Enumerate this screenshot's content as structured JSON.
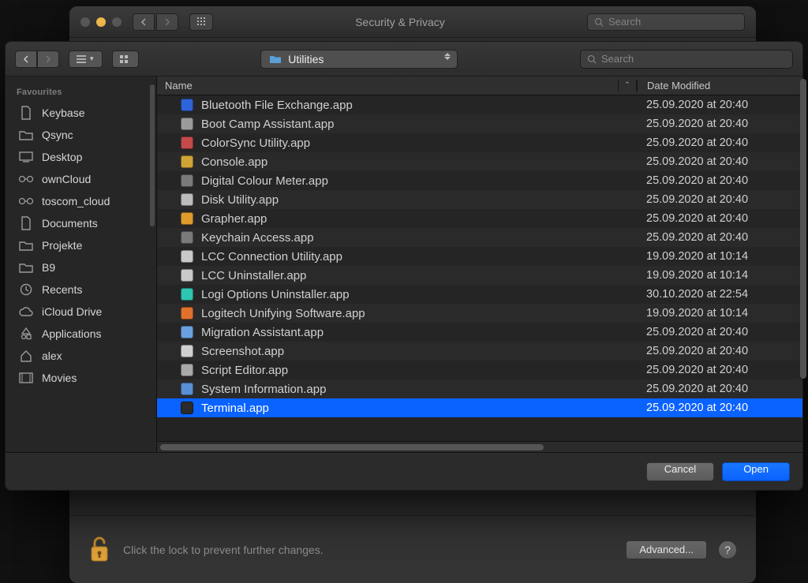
{
  "parent_window": {
    "title": "Security & Privacy",
    "search_placeholder": "Search",
    "lock_hint": "Click the lock to prevent further changes.",
    "advanced_label": "Advanced...",
    "help_label": "?"
  },
  "dialog": {
    "location_label": "Utilities",
    "search_placeholder": "Search",
    "sidebar_header": "Favourites",
    "sidebar": [
      {
        "label": "Keybase",
        "icon": "doc"
      },
      {
        "label": "Qsync",
        "icon": "folder"
      },
      {
        "label": "Desktop",
        "icon": "desktop"
      },
      {
        "label": "ownCloud",
        "icon": "cloud-sync"
      },
      {
        "label": "toscom_cloud",
        "icon": "cloud-sync"
      },
      {
        "label": "Documents",
        "icon": "doc"
      },
      {
        "label": "Projekte",
        "icon": "folder"
      },
      {
        "label": "B9",
        "icon": "folder"
      },
      {
        "label": "Recents",
        "icon": "clock"
      },
      {
        "label": "iCloud Drive",
        "icon": "cloud"
      },
      {
        "label": "Applications",
        "icon": "apps"
      },
      {
        "label": "alex",
        "icon": "home"
      },
      {
        "label": "Movies",
        "icon": "movie"
      }
    ],
    "columns": {
      "name": "Name",
      "date": "Date Modified"
    },
    "files": [
      {
        "name": "Bluetooth File Exchange.app",
        "date": "25.09.2020 at 20:40",
        "color": "#2f63d8"
      },
      {
        "name": "Boot Camp Assistant.app",
        "date": "25.09.2020 at 20:40",
        "color": "#9b9b9b"
      },
      {
        "name": "ColorSync Utility.app",
        "date": "25.09.2020 at 20:40",
        "color": "#c54a4a"
      },
      {
        "name": "Console.app",
        "date": "25.09.2020 at 20:40",
        "color": "#cfa437"
      },
      {
        "name": "Digital Colour Meter.app",
        "date": "25.09.2020 at 20:40",
        "color": "#7a7a7a"
      },
      {
        "name": "Disk Utility.app",
        "date": "25.09.2020 at 20:40",
        "color": "#bcbcbc"
      },
      {
        "name": "Grapher.app",
        "date": "25.09.2020 at 20:40",
        "color": "#e09b2d"
      },
      {
        "name": "Keychain Access.app",
        "date": "25.09.2020 at 20:40",
        "color": "#7a7a7a"
      },
      {
        "name": "LCC Connection Utility.app",
        "date": "19.09.2020 at 10:14",
        "color": "#c9c9c9"
      },
      {
        "name": "LCC Uninstaller.app",
        "date": "19.09.2020 at 10:14",
        "color": "#c9c9c9"
      },
      {
        "name": "Logi Options Uninstaller.app",
        "date": "30.10.2020 at 22:54",
        "color": "#2fc5b0"
      },
      {
        "name": "Logitech Unifying Software.app",
        "date": "19.09.2020 at 10:14",
        "color": "#e0712d"
      },
      {
        "name": "Migration Assistant.app",
        "date": "25.09.2020 at 20:40",
        "color": "#6aa0e0"
      },
      {
        "name": "Screenshot.app",
        "date": "25.09.2020 at 20:40",
        "color": "#d0d0d0"
      },
      {
        "name": "Script Editor.app",
        "date": "25.09.2020 at 20:40",
        "color": "#a9a9a9"
      },
      {
        "name": "System Information.app",
        "date": "25.09.2020 at 20:40",
        "color": "#5a8fd6"
      },
      {
        "name": "Terminal.app",
        "date": "25.09.2020 at 20:40",
        "color": "#2b2b2b",
        "selected": true
      }
    ],
    "buttons": {
      "cancel": "Cancel",
      "open": "Open"
    }
  }
}
